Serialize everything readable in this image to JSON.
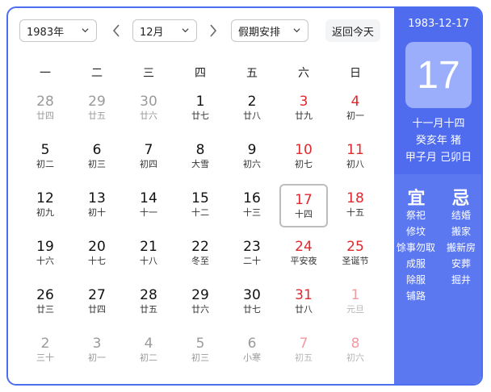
{
  "toolbar": {
    "year": "1983年",
    "month": "12月",
    "holiday": "假期安排",
    "today": "返回今天"
  },
  "weekdays": [
    "一",
    "二",
    "三",
    "四",
    "五",
    "六",
    "日"
  ],
  "weeks": [
    [
      {
        "d": "28",
        "l": "廿四",
        "o": 1
      },
      {
        "d": "29",
        "l": "廿五",
        "o": 1
      },
      {
        "d": "30",
        "l": "廿六",
        "o": 1
      },
      {
        "d": "1",
        "l": "廿七"
      },
      {
        "d": "2",
        "l": "廿八"
      },
      {
        "d": "3",
        "l": "廿九"
      },
      {
        "d": "4",
        "l": "初一"
      }
    ],
    [
      {
        "d": "5",
        "l": "初二"
      },
      {
        "d": "6",
        "l": "初三"
      },
      {
        "d": "7",
        "l": "初四"
      },
      {
        "d": "8",
        "l": "大雪"
      },
      {
        "d": "9",
        "l": "初六"
      },
      {
        "d": "10",
        "l": "初七"
      },
      {
        "d": "11",
        "l": "初八"
      }
    ],
    [
      {
        "d": "12",
        "l": "初九"
      },
      {
        "d": "13",
        "l": "初十"
      },
      {
        "d": "14",
        "l": "十一"
      },
      {
        "d": "15",
        "l": "十二"
      },
      {
        "d": "16",
        "l": "十三"
      },
      {
        "d": "17",
        "l": "十四",
        "s": 1
      },
      {
        "d": "18",
        "l": "十五"
      }
    ],
    [
      {
        "d": "19",
        "l": "十六"
      },
      {
        "d": "20",
        "l": "十七"
      },
      {
        "d": "21",
        "l": "十八"
      },
      {
        "d": "22",
        "l": "冬至"
      },
      {
        "d": "23",
        "l": "二十"
      },
      {
        "d": "24",
        "l": "平安夜"
      },
      {
        "d": "25",
        "l": "圣诞节"
      }
    ],
    [
      {
        "d": "26",
        "l": "廿三"
      },
      {
        "d": "27",
        "l": "廿四"
      },
      {
        "d": "28",
        "l": "廿五"
      },
      {
        "d": "29",
        "l": "廿六"
      },
      {
        "d": "30",
        "l": "廿七"
      },
      {
        "d": "31",
        "l": "廿八"
      },
      {
        "d": "1",
        "l": "元旦",
        "o": 1
      }
    ],
    [
      {
        "d": "2",
        "l": "三十",
        "o": 1
      },
      {
        "d": "3",
        "l": "初一",
        "o": 1
      },
      {
        "d": "4",
        "l": "初二",
        "o": 1
      },
      {
        "d": "5",
        "l": "初三",
        "o": 1
      },
      {
        "d": "6",
        "l": "小寒",
        "o": 1
      },
      {
        "d": "7",
        "l": "初五",
        "o": 1
      },
      {
        "d": "8",
        "l": "初六",
        "o": 1
      }
    ]
  ],
  "panel": {
    "date": "1983-12-17",
    "day": "17",
    "lunar": "十一月十四",
    "year_gz": "癸亥年 猪",
    "month_day_gz": "甲子月 己卯日",
    "yi_title": "宜",
    "ji_title": "忌",
    "yi": [
      "祭祀",
      "修坟",
      "馀事勿取",
      "成服",
      "除服",
      "铺路"
    ],
    "ji": [
      "结婚",
      "搬家",
      "搬新房",
      "安葬",
      "掘井"
    ]
  },
  "colors": {
    "accent": "#4e6ef2",
    "weekend": "#e0282f",
    "panel": "#5b78f0"
  }
}
